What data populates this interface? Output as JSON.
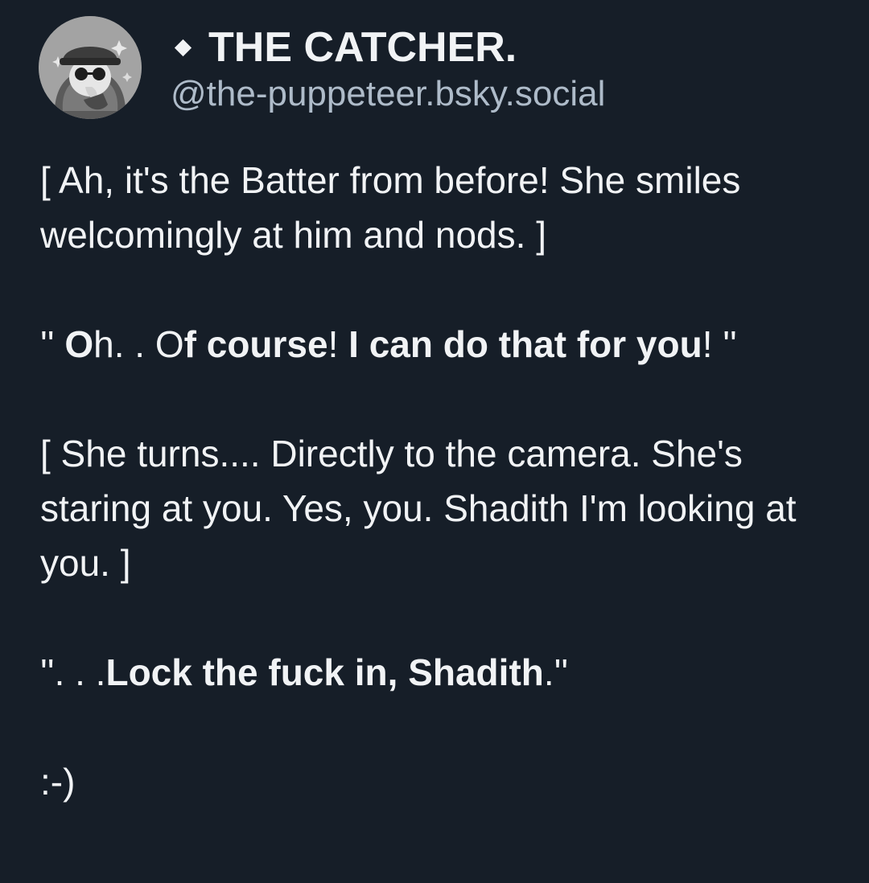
{
  "author": {
    "display_name": "THE CATCHER.",
    "handle": "@the-puppeteer.bsky.social",
    "avatar_icon": "avatar-image",
    "name_prefix_icon": "diamond-icon"
  },
  "post": {
    "p1": "[ Ah, it's the Batter from before! She smiles welcomingly at him and nods. ]",
    "p2": {
      "s1": "'' ",
      "s2": "O",
      "s3": "h. . O",
      "s4": "f ",
      "s5": "course",
      "s6": "! ",
      "s7": "I can do that for you",
      "s8": "! ''"
    },
    "p3": "[ She turns.... Directly to the camera. She's staring at you. Yes, you. Shadith I'm looking at you. ]",
    "p4": {
      "s1": "''. . .",
      "s2": "Lock the fuck in, Shadith",
      "s3": ".''"
    },
    "p5": ":-)"
  },
  "colors": {
    "background": "#161e28",
    "text": "#f1f3f5",
    "handle": "#aebbc9"
  }
}
